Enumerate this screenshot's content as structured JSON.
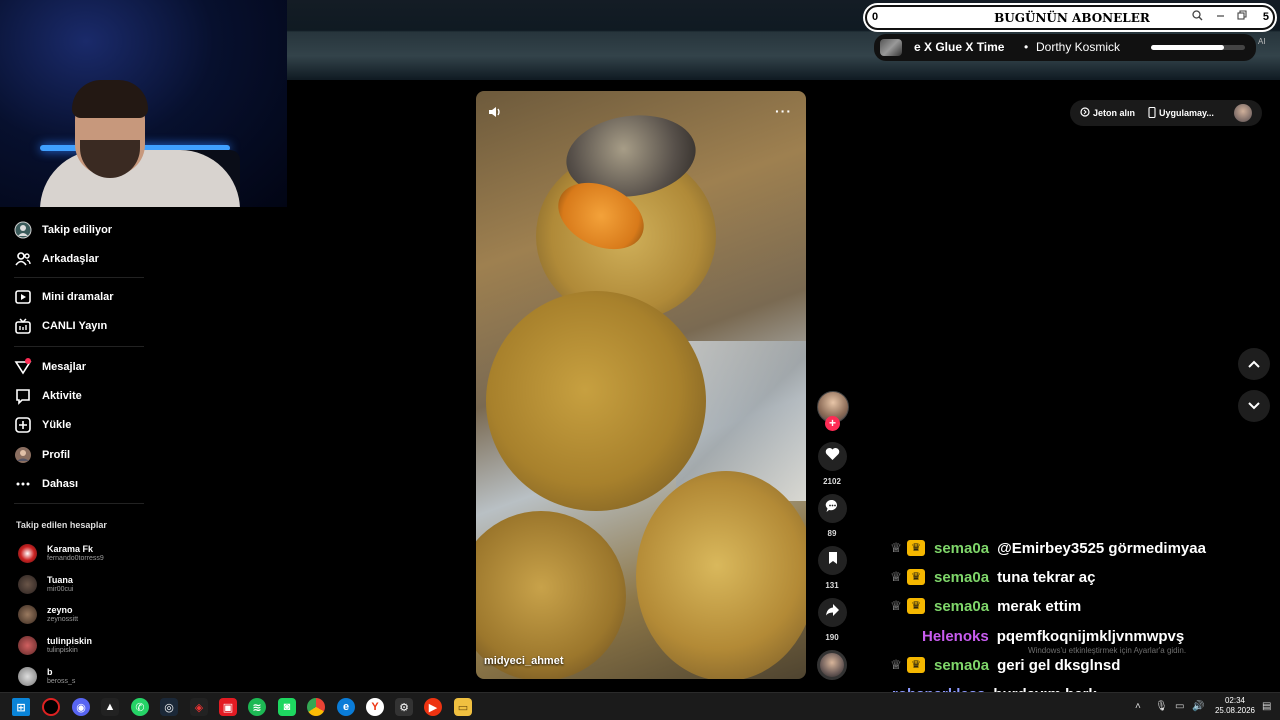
{
  "sidebar": {
    "items": [
      {
        "label": "Takip ediliyor",
        "icon": "following-icon"
      },
      {
        "label": "Arkadaşlar",
        "icon": "friends-icon"
      },
      {
        "label": "Mini dramalar",
        "icon": "mini-drama-icon"
      },
      {
        "label": "CANLI Yayın",
        "icon": "live-icon"
      },
      {
        "label": "Mesajlar",
        "icon": "messages-icon"
      },
      {
        "label": "Aktivite",
        "icon": "activity-icon"
      },
      {
        "label": "Yükle",
        "icon": "upload-icon"
      },
      {
        "label": "Profil",
        "icon": "profile-icon"
      },
      {
        "label": "Dahası",
        "icon": "more-icon"
      }
    ],
    "following_heading": "Takip edilen hesaplar",
    "accounts": [
      {
        "name": "Karama Fk",
        "username": "fernando0torress9"
      },
      {
        "name": "Tuana",
        "username": "mir00cui"
      },
      {
        "name": "zeyno",
        "username": "zeynossitt"
      },
      {
        "name": "tulinpiskin",
        "username": "tulinpiskin"
      },
      {
        "name": "b",
        "username": "beross_s"
      }
    ]
  },
  "video": {
    "owner": "midyeci_ahmet",
    "likes": "2102",
    "comments": "89",
    "saves": "131",
    "shares": "190"
  },
  "topright": {
    "coins_label": "Jeton alın",
    "app_label": "Uygulamay..."
  },
  "subscriber_bar": {
    "count": "0",
    "title": "BUGÜNÜN ABONELER",
    "right_number": "5"
  },
  "now_playing": {
    "song": "e X Glue X Time",
    "artist": "Dorthy Kosmick",
    "progress": 0.78,
    "tag": "AI"
  },
  "chat": [
    {
      "user": "sema0a",
      "message": "@Emirbey3525 görmedimyaa",
      "color": "#7fd66a",
      "badges": true
    },
    {
      "user": "sema0a",
      "message": "tuna tekrar aç",
      "color": "#7fd66a",
      "badges": true
    },
    {
      "user": "sema0a",
      "message": "merak ettim",
      "color": "#7fd66a",
      "badges": true
    },
    {
      "user": "Helenoks",
      "message": "pqemfkoqnijmkljvnmwpvş",
      "color": "#c85cf0",
      "badges": false
    },
    {
      "user": "sema0a",
      "message": "geri gel dksglnsd",
      "color": "#7fd66a",
      "badges": true
    },
    {
      "user": "robsparkless",
      "message": "burdayım berk",
      "color": "#8d9aff",
      "badges": false
    }
  ],
  "watermark": "Windows'u etkinleştirmek için Ayarlar'a gidin.",
  "taskbar": {
    "time": "02:34",
    "date": "25.08.2026"
  }
}
